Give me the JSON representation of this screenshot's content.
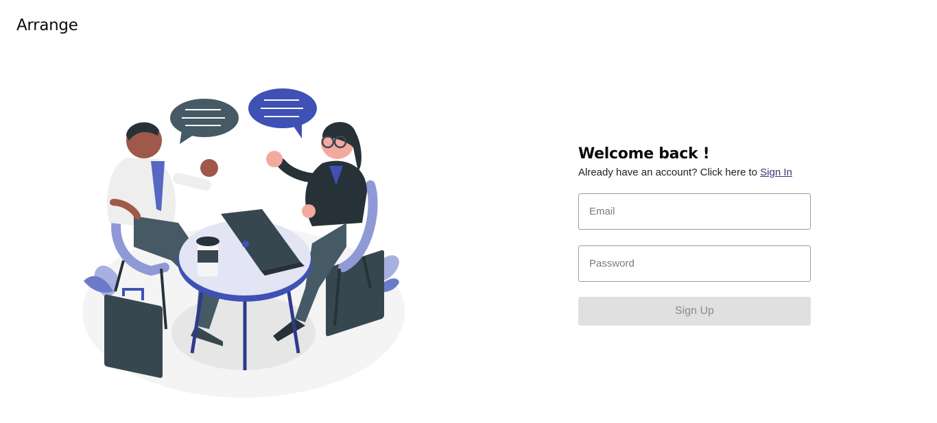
{
  "brand": {
    "name": "Arrange"
  },
  "form": {
    "title": "Welcome back !",
    "subtitle_prefix": "Already have an account? Click here to",
    "sign_in_link": "Sign In",
    "email_placeholder": "Email",
    "password_placeholder": "Password",
    "submit_label": "Sign Up"
  },
  "colors": {
    "accent": "#3f51b5",
    "link": "#3a2f7a",
    "button_disabled_bg": "#e0e0e0",
    "button_disabled_text": "#8a8a8a"
  }
}
